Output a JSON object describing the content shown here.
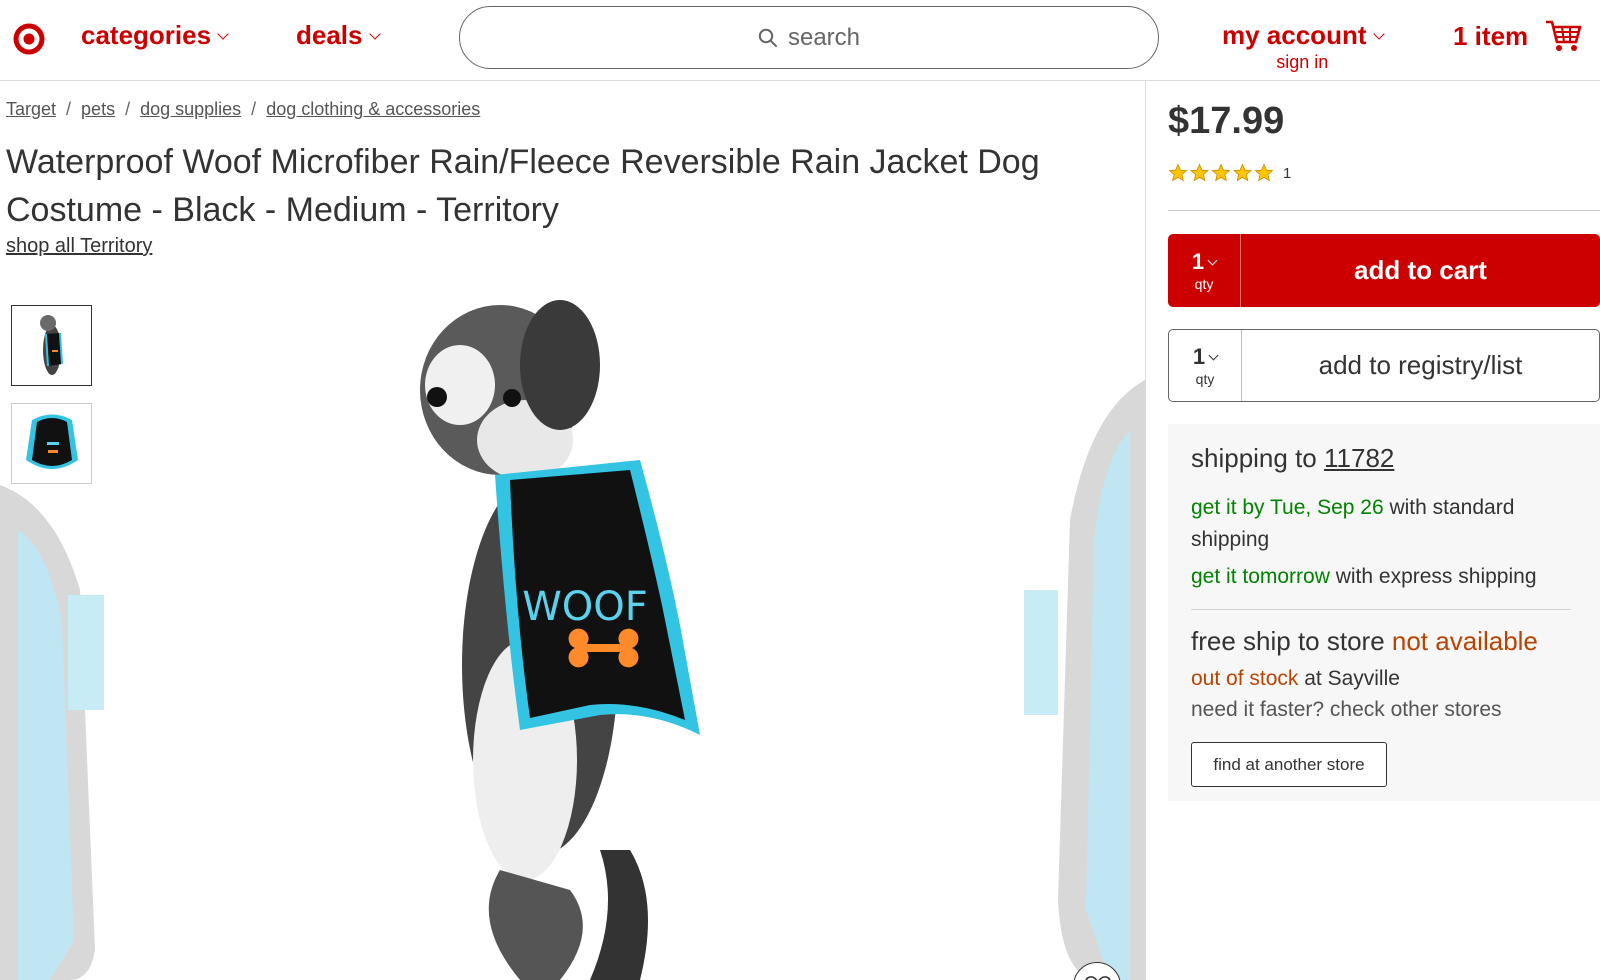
{
  "header": {
    "nav": {
      "categories_label": "categories",
      "deals_label": "deals"
    },
    "search": {
      "placeholder": "search"
    },
    "account": {
      "label": "my account",
      "sub_label": "sign in"
    },
    "cart": {
      "label": "1 item",
      "icon": "shopping-cart-icon"
    },
    "brand_color": "#cc0000"
  },
  "breadcrumb": [
    "Target",
    "pets",
    "dog supplies",
    "dog clothing & accessories"
  ],
  "product": {
    "title": "Waterproof Woof Microfiber Rain/Fleece Reversible Rain Jacket Dog Costume - Black - Medium - Territory",
    "shop_all_label": "shop all Territory",
    "image_text": "WOOF",
    "price": "$17.99",
    "rating": {
      "stars": 5,
      "max": 5,
      "count": "1"
    }
  },
  "purchase": {
    "cart_qty": "1",
    "qty_label": "qty",
    "add_to_cart_label": "add to cart",
    "registry_qty": "1",
    "add_to_registry_label": "add to registry/list"
  },
  "fulfillment": {
    "ship_to_prefix": "shipping to",
    "ship_to_zip": "11782",
    "standard_highlight": "get it by Tue, Sep 26",
    "standard_rest": " with standard shipping",
    "express_highlight": "get it tomorrow",
    "express_rest": " with express shipping",
    "store_prefix": "free ship to store",
    "store_status": "not available",
    "stock_status": "out of stock",
    "stock_location": " at Sayville",
    "faster_text": "need it faster? check other stores",
    "find_store_label": "find at another store",
    "accent_green": "#008300",
    "accent_orange": "#b84400"
  }
}
